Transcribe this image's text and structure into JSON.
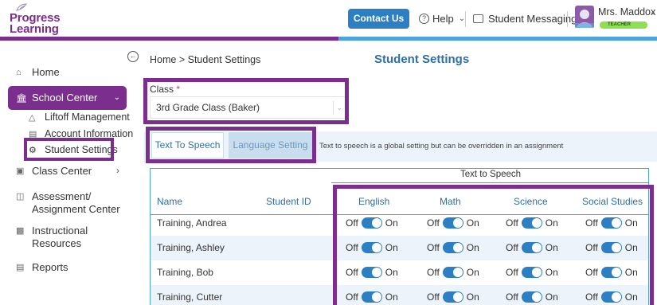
{
  "header": {
    "logo_line1": "Progress",
    "logo_line2": "Learning",
    "contact_label": "Contact Us",
    "help_label": "Help",
    "messaging_label": "Student Messaging",
    "user_name": "Mrs. Maddox",
    "user_role": "TEACHER"
  },
  "sidebar": {
    "home": "Home",
    "school_center": "School Center",
    "liftoff": "Liftoff Management",
    "account_info": "Account Information",
    "student_settings": "Student Settings",
    "class_center": "Class Center",
    "assessment_line1": "Assessment/",
    "assessment_line2": "Assignment Center",
    "instructional_line1": "Instructional",
    "instructional_line2": "Resources",
    "reports": "Reports"
  },
  "main": {
    "breadcrumb_home": "Home",
    "breadcrumb_sep": ">",
    "breadcrumb_current": "Student Settings",
    "title": "Student Settings",
    "class_label": "Class",
    "class_required": "*",
    "class_value": "3rd Grade Class (Baker)",
    "tab_tts": "Text To Speech",
    "tab_language": "Language Setting",
    "tab_note": "Text to speech is a global setting but can be overridden in an assignment"
  },
  "table": {
    "group_header": "Text to Speech",
    "col_name": "Name",
    "col_student_id": "Student ID",
    "subjects": [
      "English",
      "Math",
      "Science",
      "Social Studies"
    ],
    "off_label": "Off",
    "on_label": "On",
    "rows": [
      {
        "name": "Training, Andrea",
        "student_id": "",
        "toggles": [
          "On",
          "On",
          "On",
          "On"
        ]
      },
      {
        "name": "Training, Ashley",
        "student_id": "",
        "toggles": [
          "On",
          "On",
          "On",
          "On"
        ]
      },
      {
        "name": "Training, Bob",
        "student_id": "",
        "toggles": [
          "On",
          "On",
          "On",
          "On"
        ]
      },
      {
        "name": "Training, Cutter",
        "student_id": "",
        "toggles": [
          "On",
          "On",
          "On",
          "On"
        ]
      }
    ]
  },
  "colors": {
    "brand_purple": "#7b2e8e",
    "accent_blue": "#2d7fc4",
    "highlight_border": "#7b2e8e",
    "teacher_badge": "#8ee053"
  }
}
